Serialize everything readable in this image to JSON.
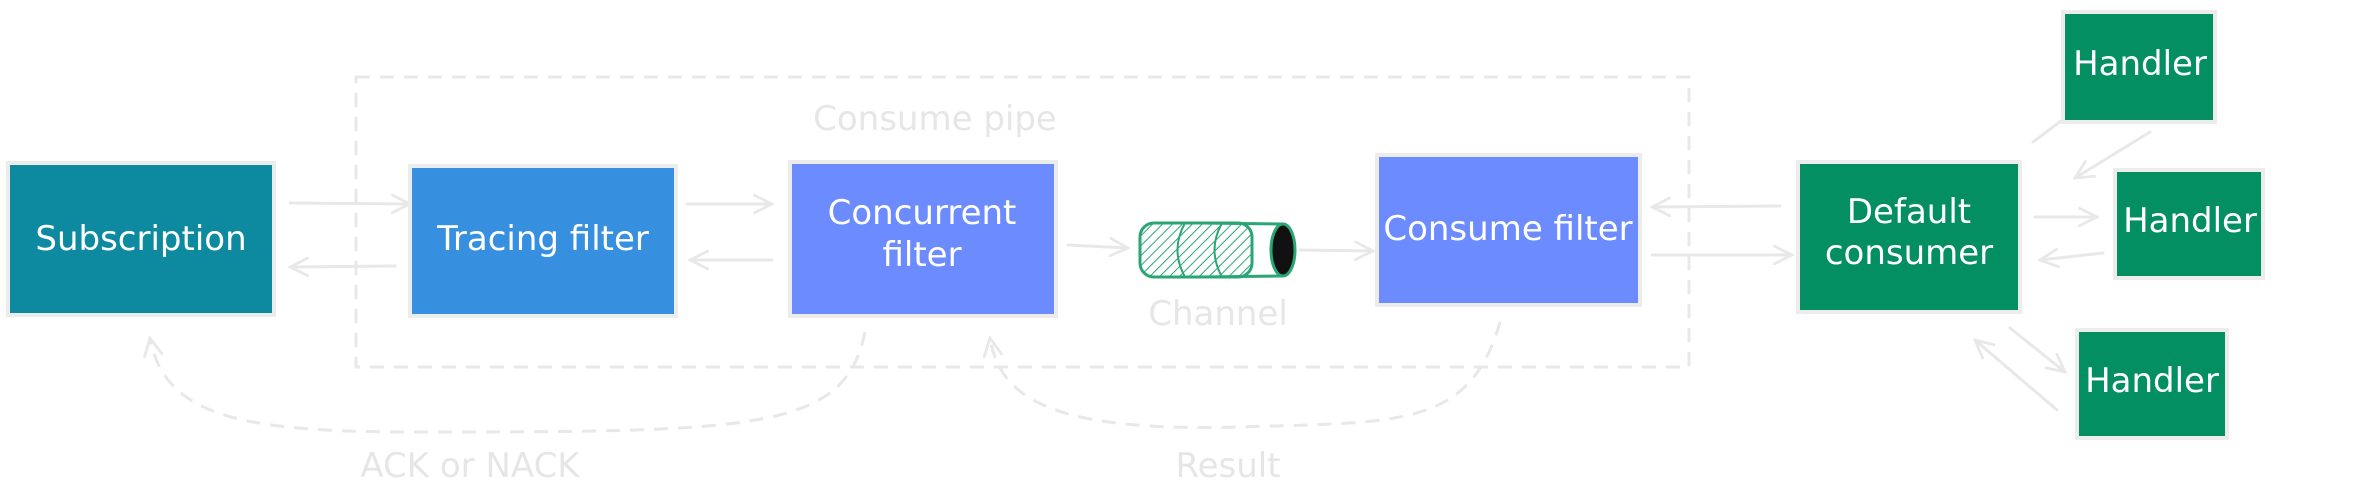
{
  "diagram": {
    "group": {
      "label": "Consume pipe"
    },
    "nodes": [
      {
        "id": "subscription",
        "label": "Subscription",
        "color": "#0e8aa0"
      },
      {
        "id": "tracing-filter",
        "label": "Tracing filter",
        "color": "#3790df"
      },
      {
        "id": "concurrent-filter",
        "label_lines": [
          "Concurrent",
          "filter"
        ],
        "color": "#6c8bff"
      },
      {
        "id": "channel",
        "label": "Channel",
        "shape": "cylinder",
        "color": "#2aa675"
      },
      {
        "id": "consume-filter",
        "label": "Consume filter",
        "color": "#6c8bff"
      },
      {
        "id": "default-consumer",
        "label_lines": [
          "Default",
          "consumer"
        ],
        "color": "#048f63"
      },
      {
        "id": "handler-1",
        "label": "Handler",
        "color": "#048f63"
      },
      {
        "id": "handler-2",
        "label": "Handler",
        "color": "#048f63"
      },
      {
        "id": "handler-3",
        "label": "Handler",
        "color": "#048f63"
      }
    ],
    "edges": [
      {
        "from": "subscription",
        "to": "tracing-filter"
      },
      {
        "from": "tracing-filter",
        "to": "subscription"
      },
      {
        "from": "tracing-filter",
        "to": "concurrent-filter"
      },
      {
        "from": "concurrent-filter",
        "to": "tracing-filter"
      },
      {
        "from": "concurrent-filter",
        "to": "channel"
      },
      {
        "from": "channel",
        "to": "consume-filter"
      },
      {
        "from": "default-consumer",
        "to": "consume-filter"
      },
      {
        "from": "consume-filter",
        "to": "default-consumer"
      },
      {
        "from": "default-consumer",
        "to": "handler-1"
      },
      {
        "from": "handler-1",
        "to": "default-consumer"
      },
      {
        "from": "default-consumer",
        "to": "handler-2"
      },
      {
        "from": "handler-2",
        "to": "default-consumer"
      },
      {
        "from": "default-consumer",
        "to": "handler-3"
      },
      {
        "from": "handler-3",
        "to": "default-consumer"
      }
    ],
    "feedback": [
      {
        "from": "concurrent-filter",
        "to": "subscription",
        "label": "ACK or NACK",
        "style": "dashed"
      },
      {
        "from": "consume-filter",
        "to": "concurrent-filter",
        "label": "Result",
        "style": "dashed"
      }
    ],
    "line_color": "#e8e8e8"
  }
}
